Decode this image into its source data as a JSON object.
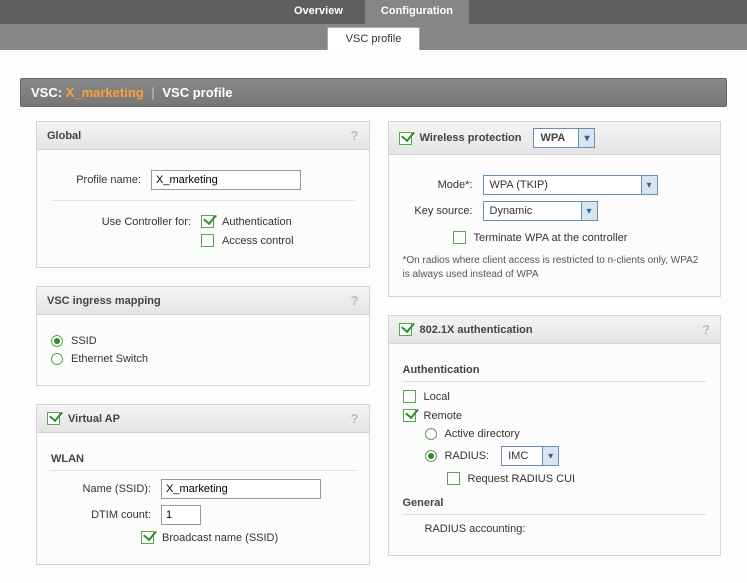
{
  "topTabs": {
    "overview": "Overview",
    "configuration": "Configuration"
  },
  "subTab": "VSC profile",
  "titleBar": {
    "prefix": "VSC:",
    "name": "X_marketing",
    "suffix": "VSC profile"
  },
  "global": {
    "header": "Global",
    "profileNameLabel": "Profile name:",
    "profileName": "X_marketing",
    "useControllerLabel": "Use Controller for:",
    "authLabel": "Authentication",
    "accessLabel": "Access control"
  },
  "ingress": {
    "header": "VSC ingress mapping",
    "ssid": "SSID",
    "eth": "Ethernet Switch"
  },
  "vap": {
    "header": "Virtual AP",
    "wlan": "WLAN",
    "nameLabel": "Name (SSID):",
    "nameValue": "X_marketing",
    "dtimLabel": "DTIM count:",
    "dtimValue": "1",
    "broadcast": "Broadcast name (SSID)"
  },
  "wprot": {
    "header": "Wireless protection",
    "headerSel": "WPA",
    "modeLabel": "Mode*:",
    "modeValue": "WPA (TKIP)",
    "keyLabel": "Key source:",
    "keyValue": "Dynamic",
    "terminate": "Terminate WPA at the controller",
    "footnote": "*On radios where client access is restricted to n-clients only, WPA2 is always used instead of WPA"
  },
  "dot1x": {
    "header": "802.1X authentication",
    "authSection": "Authentication",
    "local": "Local",
    "remote": "Remote",
    "ad": "Active directory",
    "radius": "RADIUS:",
    "radiusValue": "IMC",
    "reqCui": "Request RADIUS CUI",
    "generalSection": "General",
    "radiusAcct": "RADIUS accounting:"
  },
  "help": "?"
}
